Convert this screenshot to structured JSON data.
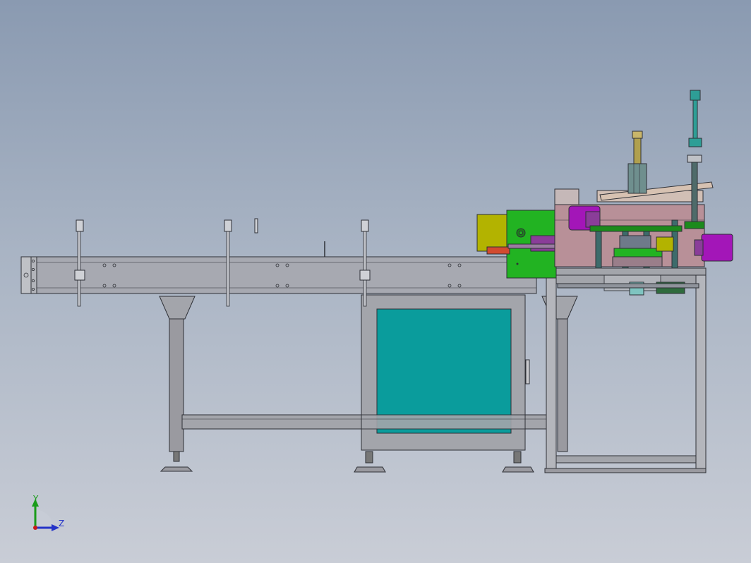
{
  "viewport": {
    "background_top": "#8a9ab1",
    "background_bottom": "#c9cdd6"
  },
  "colors": {
    "frame_gray": "#a3a5ab",
    "frame_edge": "#2e3036",
    "panel_teal": "#0a9c9c",
    "motor_green": "#22b322",
    "motor_olive": "#b3b300",
    "motor_magenta": "#a316b8",
    "cylinder_purple": "#8a3d99",
    "base_pink": "#b89098",
    "shaft_teal": "#2e9e96",
    "leg_gray": "#9a9aa0"
  },
  "triad": {
    "y_label": "Y",
    "z_label": "Z",
    "y_color": "#1a9c1a",
    "z_color": "#2433c8",
    "origin_color": "#c81a1a"
  }
}
